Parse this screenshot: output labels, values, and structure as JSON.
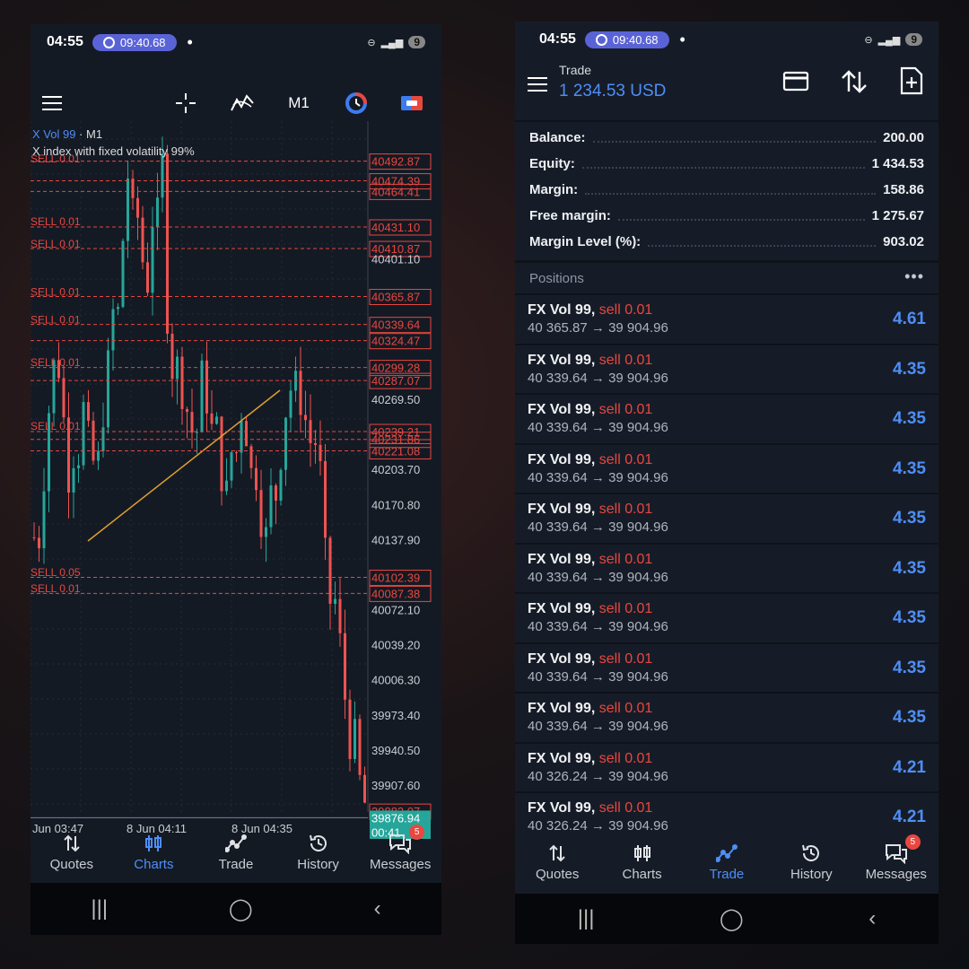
{
  "status": {
    "time": "04:55",
    "timer": "09:40.68",
    "battery": "9"
  },
  "chart_screen": {
    "timeframe": "M1",
    "symbol": "X Vol 99",
    "symbol_tf": " · M1",
    "subtitle": "X index with fixed volatility 99%",
    "price_labels": [
      "40492.87",
      "40474.39",
      "40464.41",
      "40431.10",
      "40410.87",
      "40401.10",
      "40365.87",
      "40339.64",
      "40324.47",
      "40299.28",
      "40287.07",
      "40269.50",
      "40239.21",
      "40231.86",
      "40221.08",
      "40203.70",
      "40170.80",
      "40137.90",
      "40102.39",
      "40087.38",
      "40072.10",
      "40039.20",
      "40006.30",
      "39973.40",
      "39940.50",
      "39907.60",
      "39883.07"
    ],
    "sell_labels": [
      "SELL 0.01",
      "SELL 0.01",
      "SELL 0.01",
      "SELL 0.01",
      "SELL 0.01",
      "SELL 0.01",
      "SELL 0.01",
      "SELL 0.05",
      "SELL 0.01"
    ],
    "current_price": "39876.94",
    "countdown": "00:41",
    "time_labels": [
      "Jun 03:47",
      "8 Jun 04:11",
      "8 Jun 04:35"
    ]
  },
  "nav_left": [
    {
      "label": "Quotes",
      "icon": "quotes-icon"
    },
    {
      "label": "Charts",
      "icon": "charts-icon"
    },
    {
      "label": "Trade",
      "icon": "trade-icon"
    },
    {
      "label": "History",
      "icon": "history-icon"
    },
    {
      "label": "Messages",
      "icon": "messages-icon",
      "badge": "5"
    }
  ],
  "trade_screen": {
    "title": "Trade",
    "amount": "1 234.53 USD",
    "account": [
      {
        "label": "Balance:",
        "value": "200.00"
      },
      {
        "label": "Equity:",
        "value": "1 434.53"
      },
      {
        "label": "Margin:",
        "value": "158.86"
      },
      {
        "label": "Free margin:",
        "value": "1 275.67"
      },
      {
        "label": "Margin Level (%):",
        "value": "903.02"
      }
    ],
    "positions_header": "Positions",
    "positions": [
      {
        "symbol": "FX Vol 99,",
        "side": "sell 0.01",
        "prices": "40 365.87 → 39 904.96",
        "pl": "4.61"
      },
      {
        "symbol": "FX Vol 99,",
        "side": "sell 0.01",
        "prices": "40 339.64 → 39 904.96",
        "pl": "4.35"
      },
      {
        "symbol": "FX Vol 99,",
        "side": "sell 0.01",
        "prices": "40 339.64 → 39 904.96",
        "pl": "4.35"
      },
      {
        "symbol": "FX Vol 99,",
        "side": "sell 0.01",
        "prices": "40 339.64 → 39 904.96",
        "pl": "4.35"
      },
      {
        "symbol": "FX Vol 99,",
        "side": "sell 0.01",
        "prices": "40 339.64 → 39 904.96",
        "pl": "4.35"
      },
      {
        "symbol": "FX Vol 99,",
        "side": "sell 0.01",
        "prices": "40 339.64 → 39 904.96",
        "pl": "4.35"
      },
      {
        "symbol": "FX Vol 99,",
        "side": "sell 0.01",
        "prices": "40 339.64 → 39 904.96",
        "pl": "4.35"
      },
      {
        "symbol": "FX Vol 99,",
        "side": "sell 0.01",
        "prices": "40 339.64 → 39 904.96",
        "pl": "4.35"
      },
      {
        "symbol": "FX Vol 99,",
        "side": "sell 0.01",
        "prices": "40 339.64 → 39 904.96",
        "pl": "4.35"
      },
      {
        "symbol": "FX Vol 99,",
        "side": "sell 0.01",
        "prices": "40 326.24 → 39 904.96",
        "pl": "4.21"
      },
      {
        "symbol": "FX Vol 99,",
        "side": "sell 0.01",
        "prices": "40 326.24 → 39 904.96",
        "pl": "4.21"
      }
    ]
  },
  "nav_right": [
    {
      "label": "Quotes",
      "icon": "quotes-icon"
    },
    {
      "label": "Charts",
      "icon": "charts-icon"
    },
    {
      "label": "Trade",
      "icon": "trade-icon"
    },
    {
      "label": "History",
      "icon": "history-icon"
    },
    {
      "label": "Messages",
      "icon": "messages-icon",
      "badge": "5"
    }
  ],
  "colors": {
    "accent": "#4e8ef7",
    "bull": "#26a69a",
    "bear": "#ef5350",
    "sell_line": "#e9473f",
    "trend": "#e0a030"
  }
}
